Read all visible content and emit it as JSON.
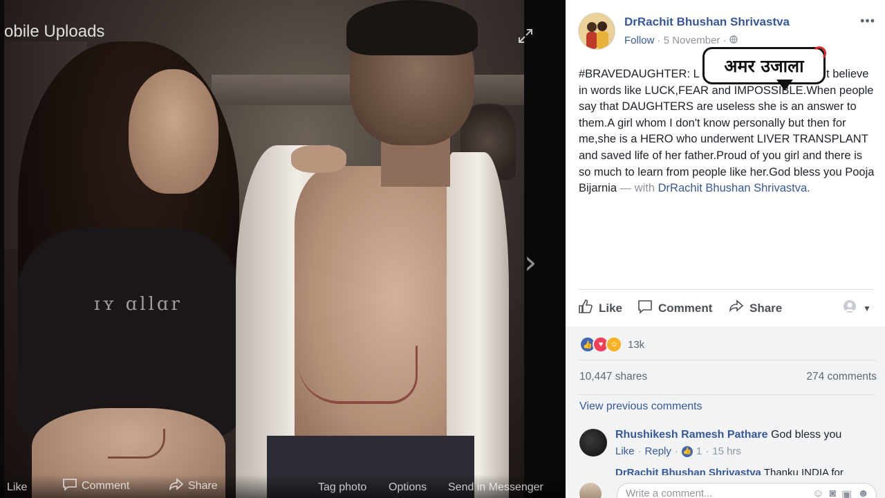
{
  "viewer": {
    "album_label": "obile Uploads",
    "shirt_text": "ɪʏ ɑllɑr",
    "actions": {
      "like": "Like",
      "comment": "Comment",
      "share": "Share",
      "tag_photo": "Tag photo",
      "options": "Options",
      "send": "Send in Messenger"
    }
  },
  "post": {
    "author": "DrRachit Bhushan Shrivastva",
    "follow": "Follow",
    "date": "5 November",
    "text_main": "#BRAVEDAUGHTER: L LIFE HEROES who don't believe in words like LUCK,FEAR and IMPOSSIBLE.When people say that DAUGHTERS are useless she is an answer to them.A girl whom I don't know personally but then for me,she is a HERO who underwent LIVER TRANSPLANT and saved life of her father.Proud of you girl and there is so much to learn from people like her.God bless you Pooja Bijarnia",
    "text_with": " — with ",
    "text_tag": "DrRachit Bhushan Shrivastva.",
    "actions": {
      "like": "Like",
      "comment": "Comment",
      "share": "Share"
    }
  },
  "watermark": {
    "text": "अमर उजाला"
  },
  "engagement": {
    "reaction_count": "13k",
    "shares": "10,447 shares",
    "comments": "274 comments",
    "view_previous": "View previous comments"
  },
  "comments": [
    {
      "name": "Rhushikesh Ramesh Pathare",
      "text": "God bless you",
      "like": "Like",
      "reply": "Reply",
      "likes": "1",
      "time": "15 hrs"
    },
    {
      "name": "DrRachit Bhushan Shrivastva",
      "text": "Thanku INDIA for"
    }
  ],
  "compose": {
    "placeholder": "Write a comment..."
  },
  "colors": {
    "link": "#365899",
    "like_blue": "#4267b2",
    "love_red": "#f33e58",
    "wow_yellow": "#f7b125"
  }
}
